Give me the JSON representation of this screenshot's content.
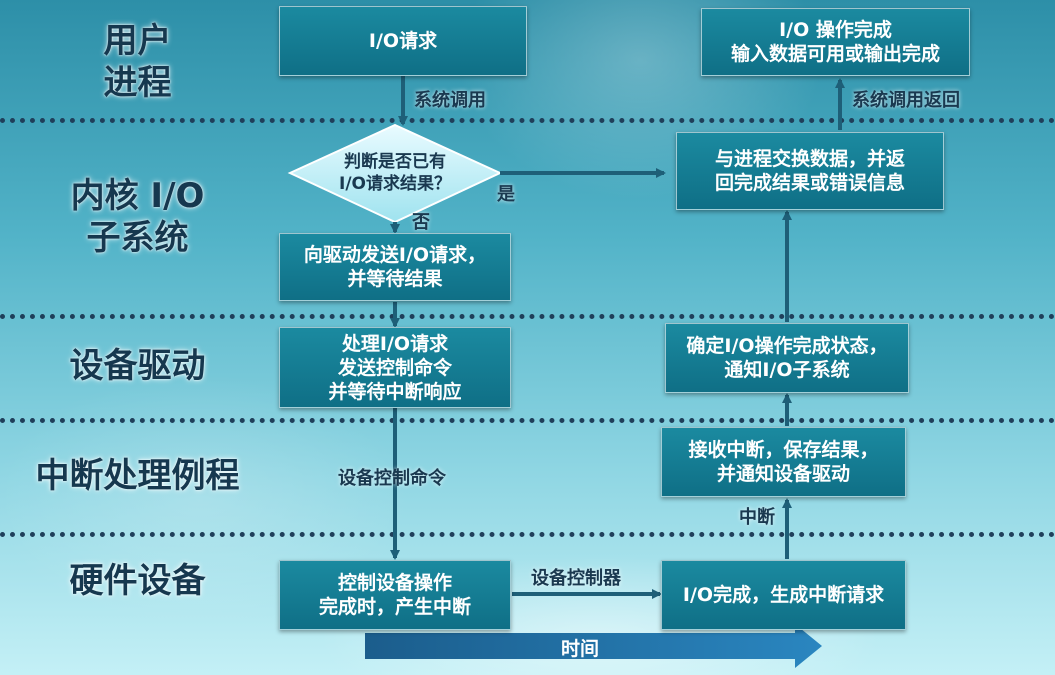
{
  "lanes": [
    {
      "label": "用户\n进程"
    },
    {
      "label": "内核 I/O\n子系统"
    },
    {
      "label": "设备驱动"
    },
    {
      "label": "中断处理例程"
    },
    {
      "label": "硬件设备"
    }
  ],
  "nodes": {
    "io_request": "I/O请求",
    "check_result": "判断是否已有\nI/O请求结果？",
    "send_to_driver": "向驱动发送I/O请求，\n并等待结果",
    "process_request": "处理I/O请求\n发送控制命令\n并等待中断响应",
    "control_device": "控制设备操作\n完成时，产生中断",
    "io_complete_interrupt": "I/O完成，生成中断请求",
    "receive_interrupt": "接收中断，保存结果，\n并通知设备驱动",
    "confirm_status": "确定I/O操作完成状态，\n通知I/O子系统",
    "exchange_data": "与进程交换数据，并返\n回完成结果或错误信息",
    "io_done": "I/O 操作完成\n输入数据可用或输出完成"
  },
  "edges": {
    "syscall": "系统调用",
    "yes": "是",
    "no": "否",
    "device_control_cmd": "设备控制命令",
    "device_controller": "设备控制器",
    "interrupt": "中断",
    "syscall_return": "系统调用返回"
  },
  "timeline": {
    "label": "时间"
  }
}
